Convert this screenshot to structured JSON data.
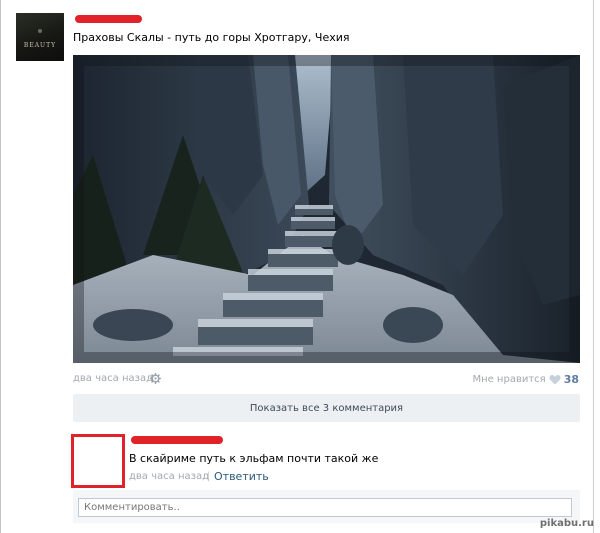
{
  "post": {
    "text": "Праховы Скалы - путь до горы Хротгару, Чехия",
    "avatar_logo": "BEAUTY",
    "time": "два часа назад",
    "like_label": "Мне нравится",
    "like_count": "38"
  },
  "comments": {
    "show_all_label": "Показать все 3 комментария",
    "items": [
      {
        "text": "В скайриме путь к эльфам почти такой же",
        "time": "два часа назад",
        "separator": "|",
        "reply_label": "Ответить"
      }
    ],
    "input_placeholder": "Комментировать.."
  },
  "watermark": "pikabu.ru",
  "colors": {
    "redaction": "#e0222b",
    "link": "#2b587a",
    "like_count": "#5d7da1",
    "muted": "#a2a9b1",
    "button_bg": "#edf0f3"
  },
  "icons": [
    "gear-icon",
    "heart-icon"
  ]
}
